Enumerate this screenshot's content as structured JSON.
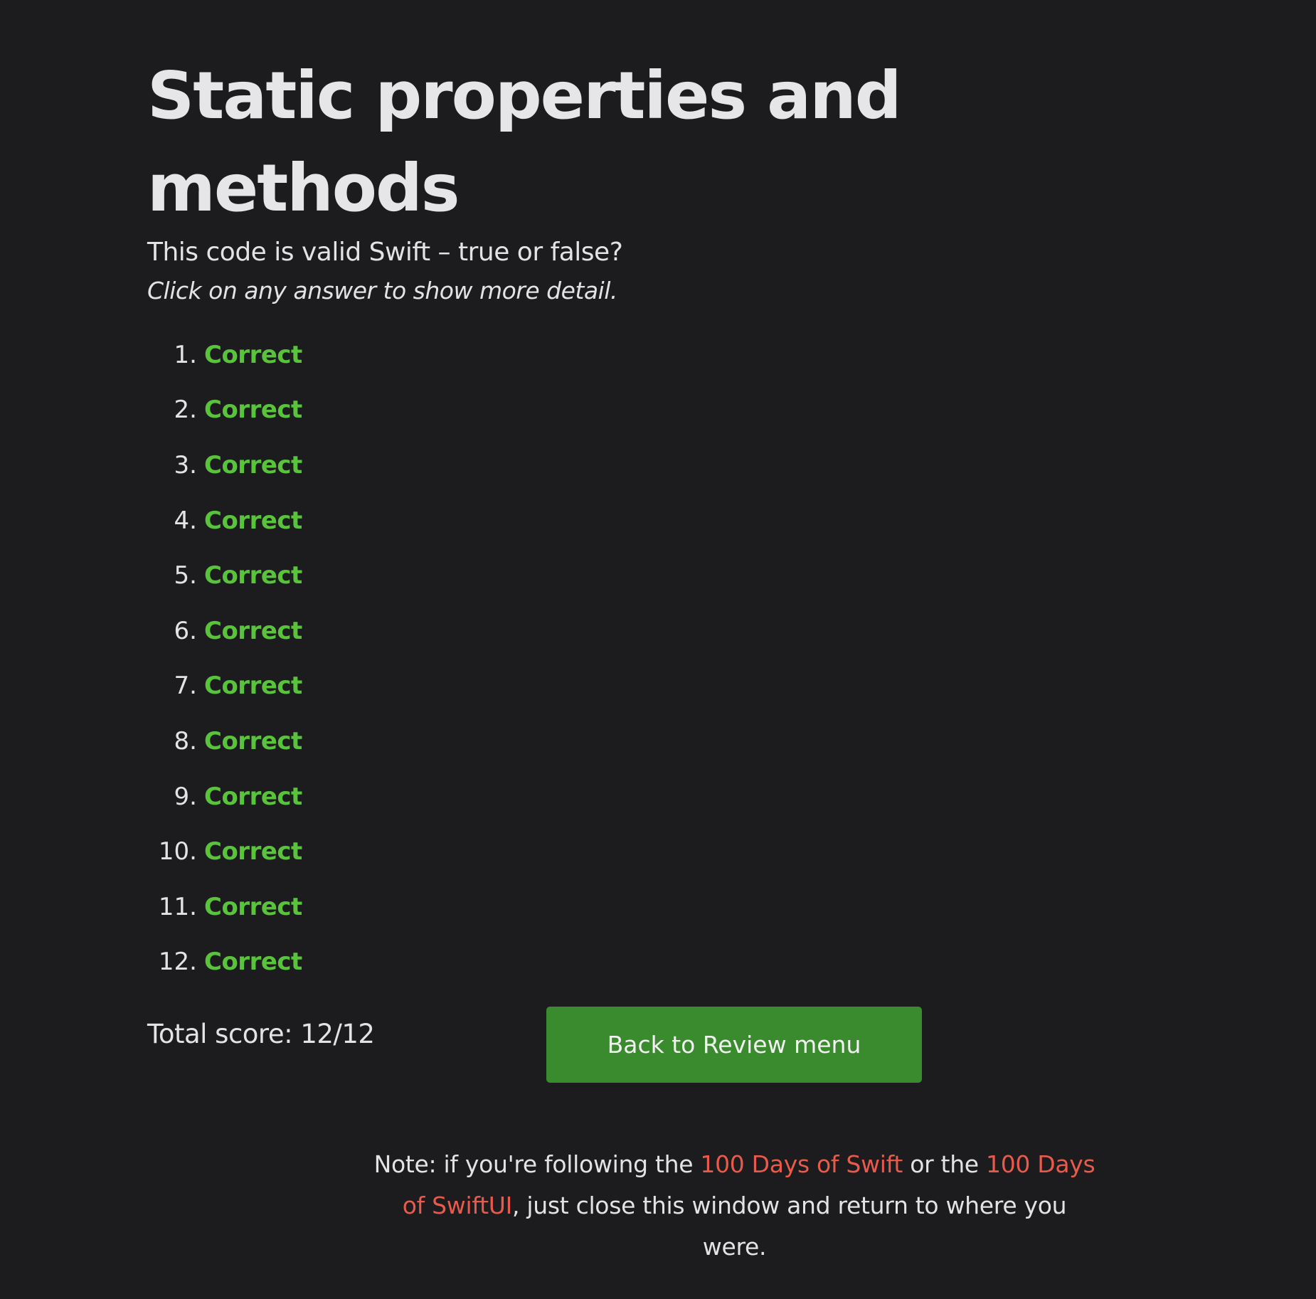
{
  "page": {
    "title": "Static properties and methods",
    "question": "This code is valid Swift – true or false?",
    "hint": "Click on any answer to show more detail."
  },
  "answers": [
    {
      "number": "1.",
      "label": "Correct"
    },
    {
      "number": "2.",
      "label": "Correct"
    },
    {
      "number": "3.",
      "label": "Correct"
    },
    {
      "number": "4.",
      "label": "Correct"
    },
    {
      "number": "5.",
      "label": "Correct"
    },
    {
      "number": "6.",
      "label": "Correct"
    },
    {
      "number": "7.",
      "label": "Correct"
    },
    {
      "number": "8.",
      "label": "Correct"
    },
    {
      "number": "9.",
      "label": "Correct"
    },
    {
      "number": "10.",
      "label": "Correct"
    },
    {
      "number": "11.",
      "label": "Correct"
    },
    {
      "number": "12.",
      "label": "Correct"
    }
  ],
  "score": {
    "text": "Total score: 12/12"
  },
  "back_button": {
    "label": "Back to Review menu"
  },
  "note": {
    "prefix": "Note: if you're following the ",
    "link1": "100 Days of Swift",
    "middle": " or the ",
    "link2": "100 Days of SwiftUI",
    "suffix": ", just close this window and return to where you were."
  },
  "colors": {
    "background": "#1c1c1e",
    "correct": "#59c33c",
    "button": "#3a8a2e",
    "link": "#e85a4b"
  }
}
